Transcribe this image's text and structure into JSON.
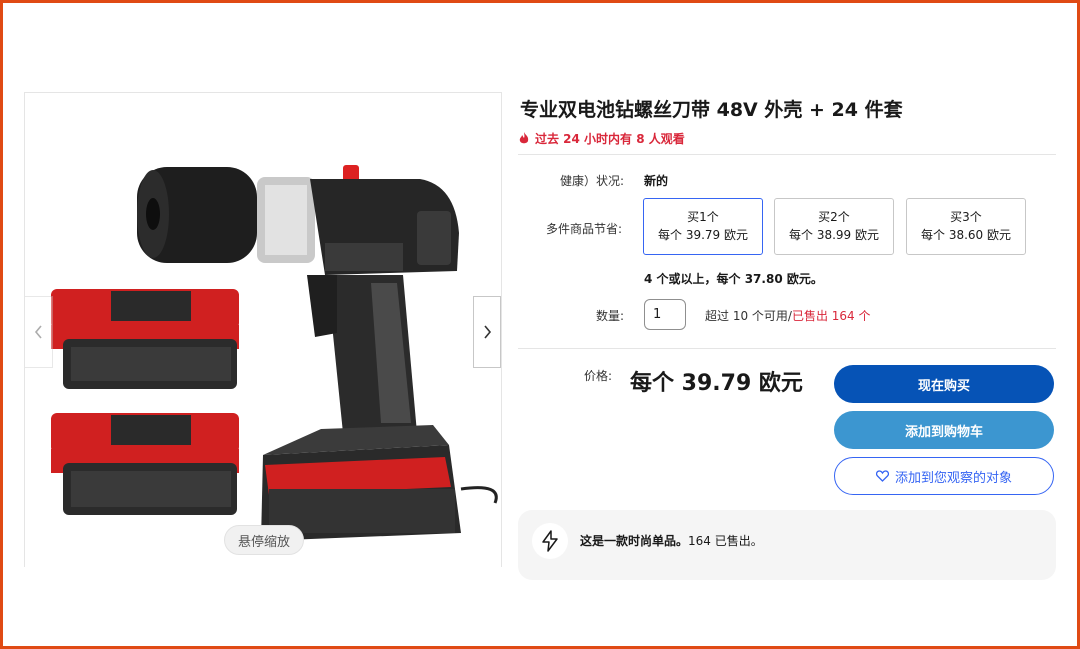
{
  "gallery": {
    "zoom_label": "悬停缩放",
    "prev_icon": "chevron-left-icon",
    "next_icon": "chevron-right-icon"
  },
  "product": {
    "title": "专业双电池钻螺丝刀带 48V 外壳 + 24 件套",
    "watchers": "过去 24 小时内有 8 人观看"
  },
  "condition": {
    "label": "健康）状况:",
    "value": "新的"
  },
  "multi_buy": {
    "label": "多件商品节省:",
    "tiers": [
      {
        "qty": "买1个",
        "price": "每个 39.79 欧元"
      },
      {
        "qty": "买2个",
        "price": "每个 38.99 欧元"
      },
      {
        "qty": "买3个",
        "price": "每个 38.60 欧元"
      }
    ],
    "note": "4 个或以上，每个 37.80 欧元。"
  },
  "quantity": {
    "label": "数量:",
    "value": "1",
    "available": "超过 10 个可用/",
    "sold": "已售出 164 个"
  },
  "price": {
    "label": "价格:",
    "value": "每个 39.79 欧元"
  },
  "actions": {
    "buy_now": "现在购买",
    "add_to_cart": "添加到购物车",
    "watch": "添加到您观察的对象"
  },
  "promo": {
    "bold": "这是一款时尚单品。",
    "rest": "164 已售出。"
  },
  "colors": {
    "accent": "#3665f3",
    "buy": "#0653b6",
    "cart": "#3c96d0",
    "urgent": "#d9273a",
    "frame": "#e04a14"
  }
}
